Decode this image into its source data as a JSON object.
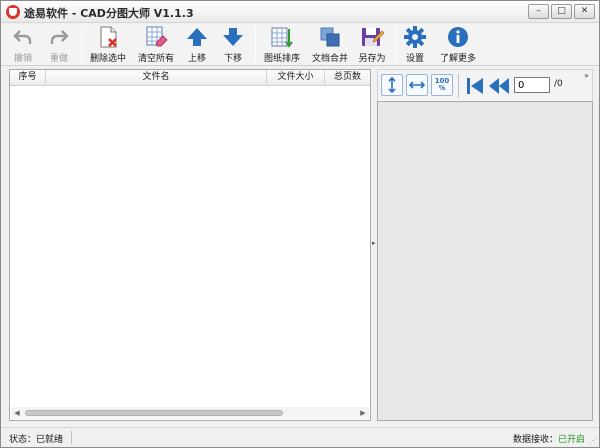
{
  "window": {
    "title": "途易软件 - CAD分图大师 V1.1.3",
    "controls": {
      "minimize": "–",
      "maximize": "□",
      "close": "✕"
    }
  },
  "toolbar": {
    "undo": "撤销",
    "redo": "重做",
    "delete_selected": "删除选中",
    "clear_all": "清空所有",
    "move_up": "上移",
    "move_down": "下移",
    "sort_drawings": "图纸排序",
    "merge_docs": "文档合并",
    "save_as": "另存为",
    "settings": "设置",
    "learn_more": "了解更多"
  },
  "file_table": {
    "columns": [
      "序号",
      "文件名",
      "文件大小",
      "总页数"
    ],
    "rows": []
  },
  "preview": {
    "page_value": "0",
    "page_total": "/0",
    "zoom_label": "100\n%",
    "more": "»"
  },
  "status": {
    "label": "状态：已就绪",
    "data_label": "数据接收：",
    "data_value": "已开启"
  },
  "colors": {
    "accent_blue": "#2a6fbe",
    "status_green": "#1f9a1f"
  }
}
